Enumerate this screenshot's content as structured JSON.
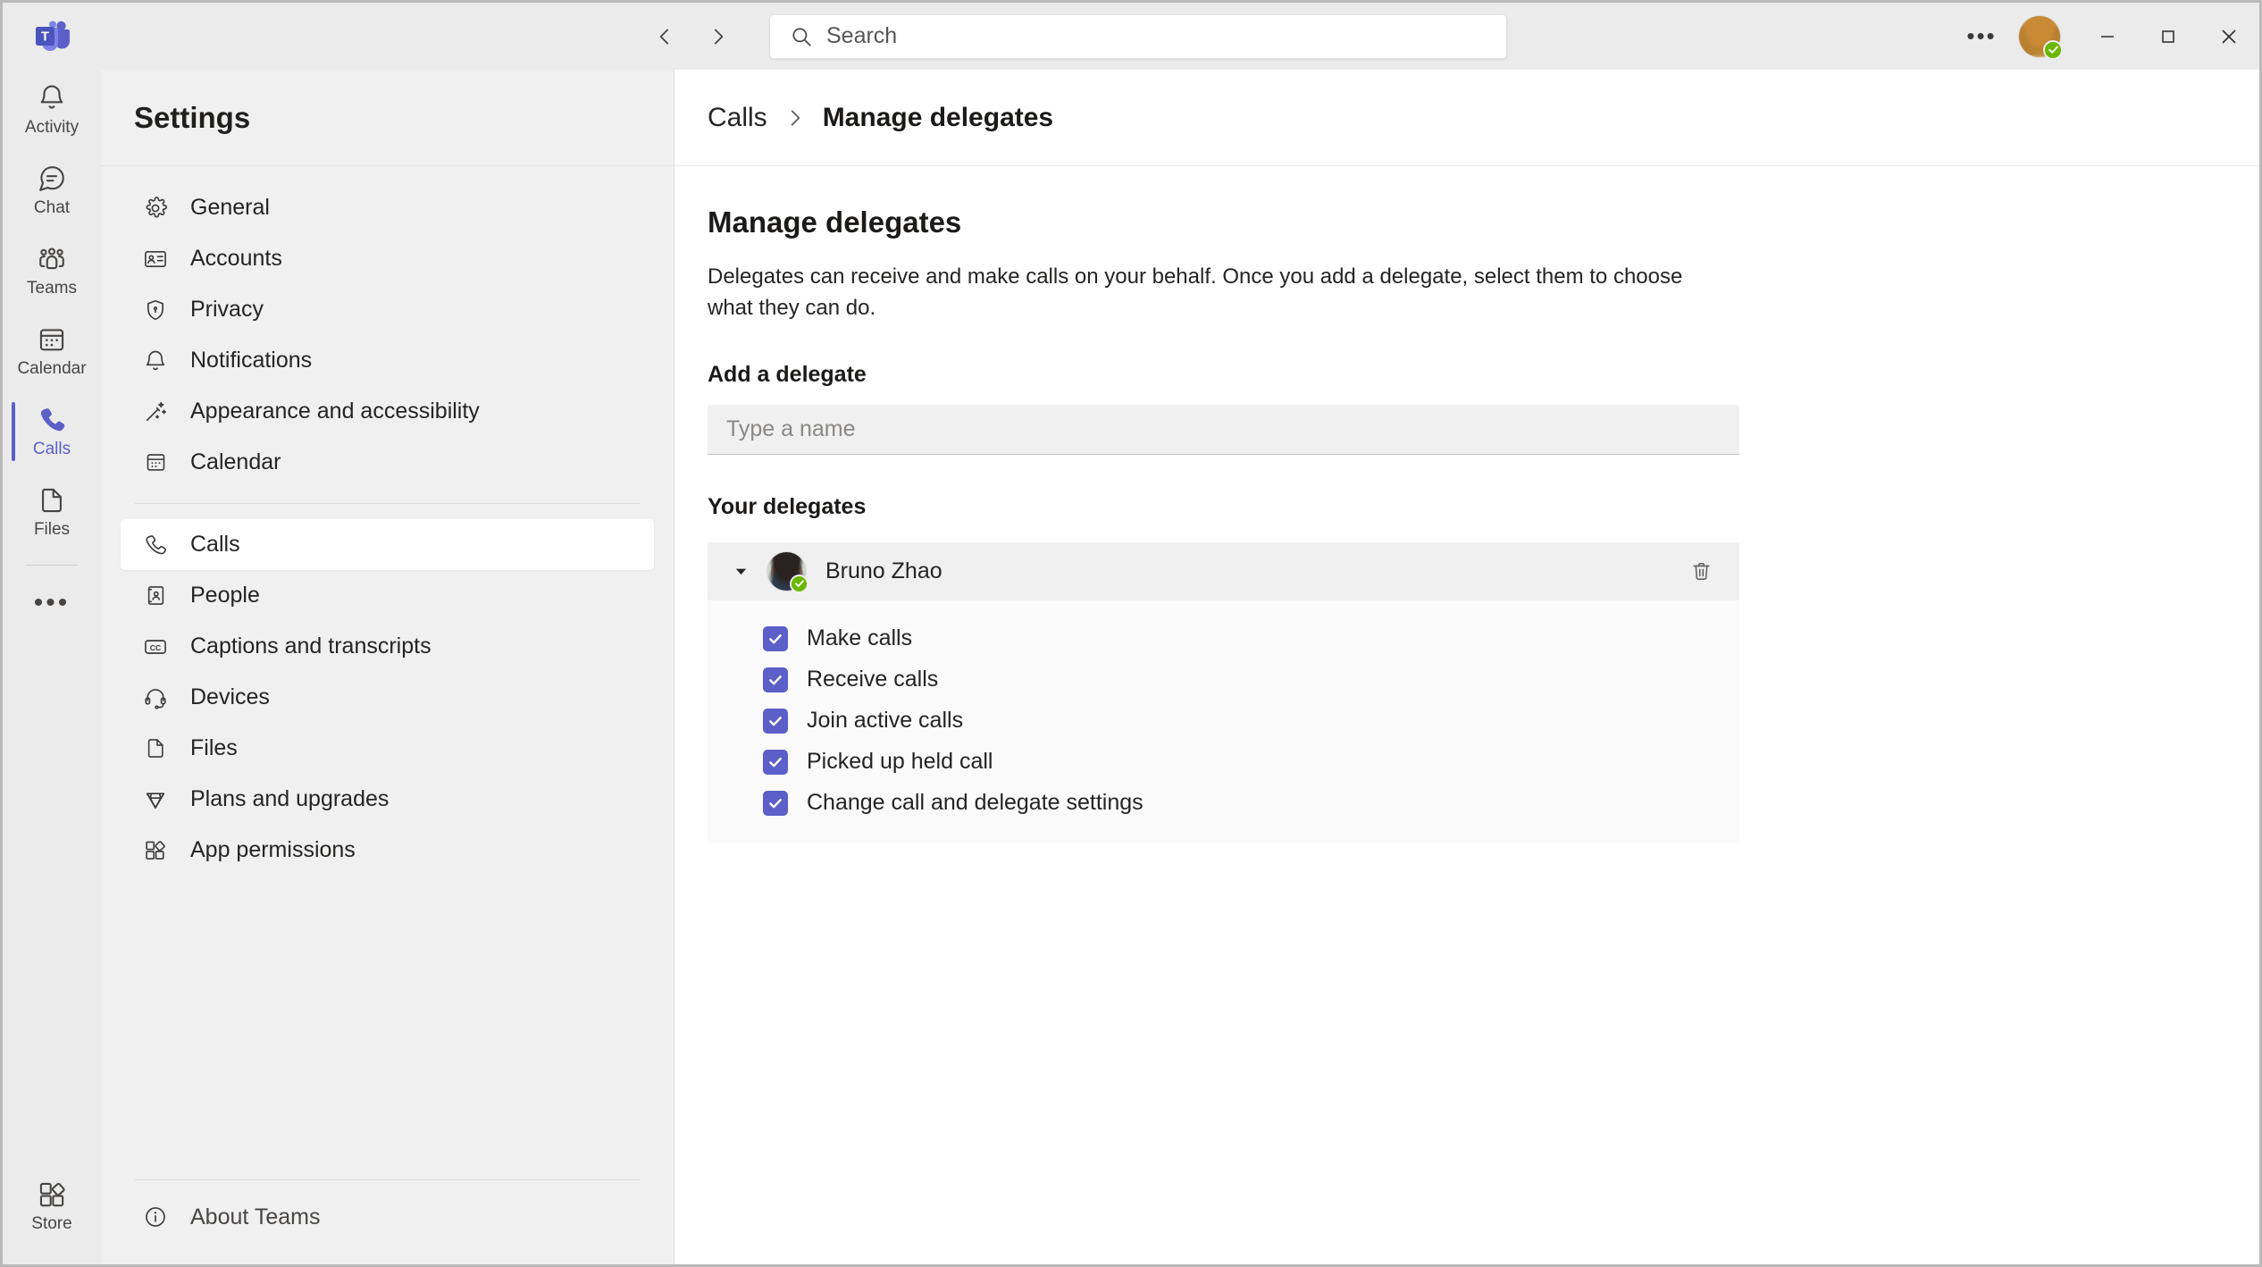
{
  "titlebar": {
    "logo_icon": "teams-logo-icon",
    "back_icon": "chevron-left-icon",
    "forward_icon": "chevron-right-icon",
    "search": {
      "placeholder": "Search",
      "value": "",
      "icon": "search-icon"
    },
    "more_label": "•••",
    "more_icon": "more-horizontal-icon",
    "avatar_icon": "user-avatar",
    "presence_status": "available",
    "minimize_icon": "minimize-icon",
    "maximize_icon": "maximize-icon",
    "close_icon": "close-icon"
  },
  "rail": {
    "items": [
      {
        "label": "Activity",
        "icon": "bell-icon",
        "active": false
      },
      {
        "label": "Chat",
        "icon": "chat-icon",
        "active": false
      },
      {
        "label": "Teams",
        "icon": "people-team-icon",
        "active": false
      },
      {
        "label": "Calendar",
        "icon": "calendar-icon",
        "active": false
      },
      {
        "label": "Calls",
        "icon": "phone-icon",
        "active": true
      },
      {
        "label": "Files",
        "icon": "document-icon",
        "active": false
      }
    ],
    "more_label": "•••",
    "store": {
      "label": "Store",
      "icon": "store-icon"
    }
  },
  "settings": {
    "title": "Settings",
    "items": [
      {
        "label": "General",
        "icon": "gear-icon",
        "active": false
      },
      {
        "label": "Accounts",
        "icon": "id-card-icon",
        "active": false
      },
      {
        "label": "Privacy",
        "icon": "shield-lock-icon",
        "active": false
      },
      {
        "label": "Notifications",
        "icon": "bell-icon",
        "active": false
      },
      {
        "label": "Appearance and accessibility",
        "icon": "wand-icon",
        "active": false
      },
      {
        "label": "Calendar",
        "icon": "calendar-icon",
        "active": false
      }
    ],
    "items2": [
      {
        "label": "Calls",
        "icon": "phone-icon",
        "active": true
      },
      {
        "label": "People",
        "icon": "contact-card-icon",
        "active": false
      },
      {
        "label": "Captions and transcripts",
        "icon": "closed-caption-icon",
        "active": false
      },
      {
        "label": "Devices",
        "icon": "headset-icon",
        "active": false
      },
      {
        "label": "Files",
        "icon": "document-icon",
        "active": false
      },
      {
        "label": "Plans and upgrades",
        "icon": "diamond-icon",
        "active": false
      },
      {
        "label": "App permissions",
        "icon": "apps-icon",
        "active": false
      }
    ],
    "about": {
      "label": "About Teams",
      "icon": "info-circle-icon"
    }
  },
  "breadcrumb": {
    "parent": "Calls",
    "separator_icon": "chevron-right-icon",
    "current": "Manage delegates"
  },
  "main": {
    "title": "Manage delegates",
    "description": "Delegates can receive and make calls on your behalf. Once you add a delegate, select them to choose what they can do.",
    "add_label": "Add a delegate",
    "add_input": {
      "placeholder": "Type a name",
      "value": ""
    },
    "delegates_label": "Your delegates",
    "delegate": {
      "name": "Bruno Zhao",
      "expanded": true,
      "expand_icon": "chevron-down-icon",
      "presence_status": "available",
      "avatar_icon": "user-avatar",
      "delete_icon": "trash-icon",
      "permissions": [
        {
          "label": "Make calls",
          "checked": true
        },
        {
          "label": "Receive calls",
          "checked": true
        },
        {
          "label": "Join active calls",
          "checked": true
        },
        {
          "label": "Picked up held call",
          "checked": true
        },
        {
          "label": "Change call and delegate settings",
          "checked": true
        }
      ]
    }
  },
  "colors": {
    "accent": "#5b5fc7",
    "presence_available": "#6bb700",
    "rail_bg": "#ebebeb",
    "panel_bg": "#f0f0f0",
    "content_bg": "#ffffff"
  }
}
